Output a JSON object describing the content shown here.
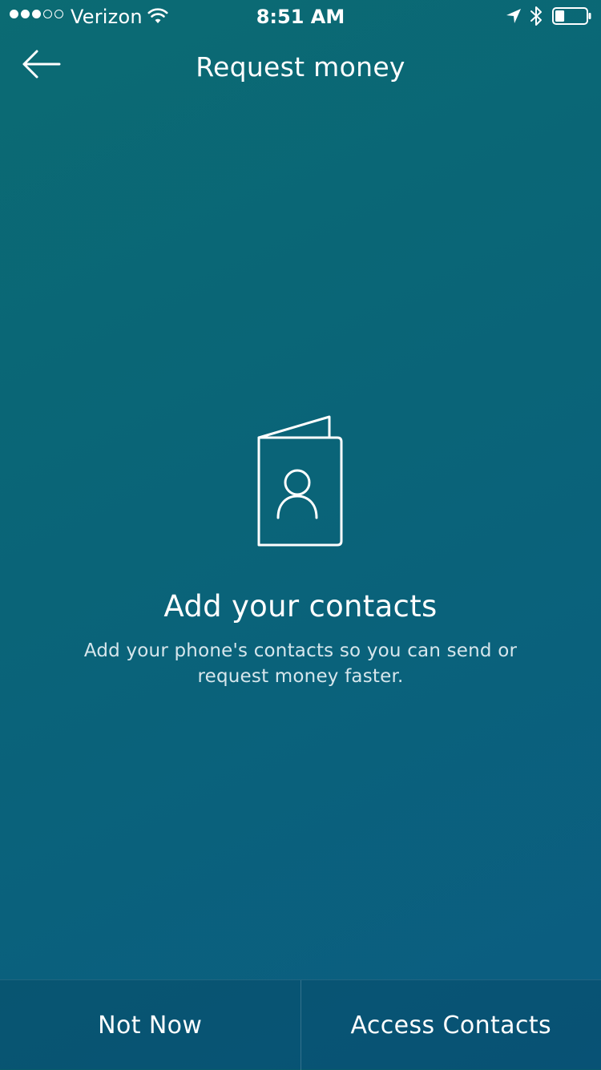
{
  "status_bar": {
    "carrier": "Verizon",
    "time": "8:51 AM",
    "signal_bars_filled": 3,
    "signal_bars_total": 5,
    "battery_level": 0.3
  },
  "nav": {
    "title": "Request money",
    "back_icon": "arrow-left-icon"
  },
  "empty_state": {
    "icon": "address-book-icon",
    "title": "Add your contacts",
    "body": "Add your phone's contacts so you can send or request money faster."
  },
  "actions": {
    "not_now_label": "Not Now",
    "access_contacts_label": "Access Contacts"
  },
  "colors": {
    "background_start": "#0b6b73",
    "background_end": "#0b5d82",
    "text": "#ffffff"
  }
}
